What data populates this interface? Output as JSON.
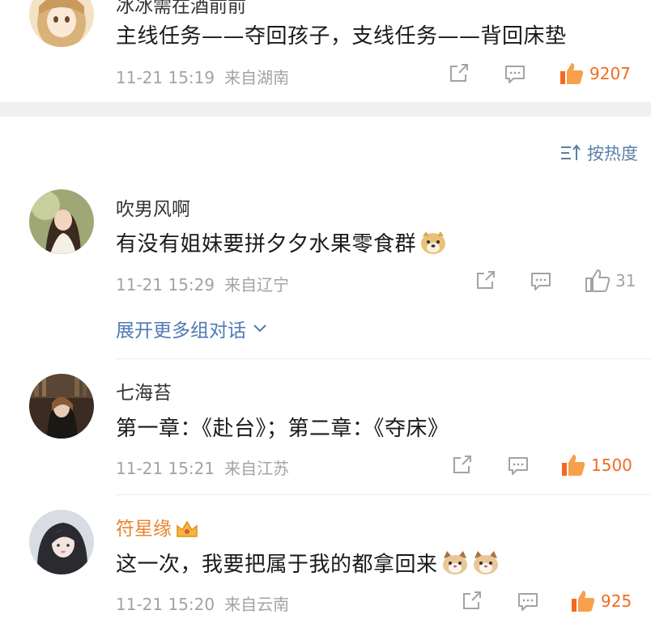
{
  "top_comment": {
    "username": "冰冰需在酒前前",
    "content": "主线任务——夺回孩子，支线任务——背回床垫",
    "time": "11-21 15:19",
    "location": "来自湖南",
    "likes": "9207"
  },
  "sort": {
    "label": "按热度",
    "icon": "sort-icon"
  },
  "comments": [
    {
      "username": "吹男风啊",
      "content": "有没有姐妹要拼夕夕水果零食群",
      "time": "11-21 15:29",
      "location": "来自辽宁",
      "likes": "31",
      "expand_label": "展开更多组对话"
    },
    {
      "username": "七海苔",
      "content": "第一章：《赴台》；第二章：《夺床》",
      "time": "11-21 15:21",
      "location": "来自江苏",
      "likes": "1500"
    },
    {
      "username": "符星缘",
      "content": "这一次，我要把属于我的都拿回来",
      "time": "11-21 15:20",
      "location": "来自云南",
      "likes": "925"
    }
  ],
  "colors": {
    "accent_like": "#f26b21",
    "link_blue": "#4f7ab3",
    "meta_gray": "#a3a3a3",
    "vip_name": "#e8852b"
  }
}
